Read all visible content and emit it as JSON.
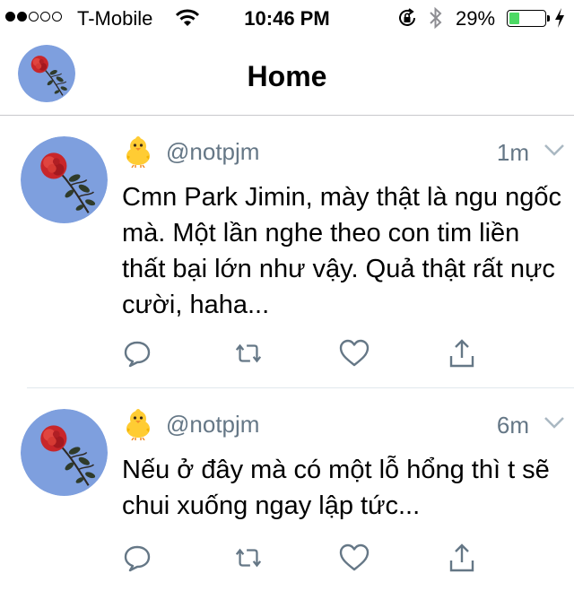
{
  "status_bar": {
    "carrier": "T-Mobile",
    "time": "10:46 PM",
    "battery_percent": "29%",
    "battery_level": 0.29,
    "signal_strength": 2,
    "signal_total": 5,
    "icons": [
      "signal-dots-icon",
      "wifi-icon",
      "rotation-lock-icon",
      "bluetooth-icon",
      "battery-icon",
      "charging-bolt-icon"
    ]
  },
  "nav": {
    "title": "Home",
    "avatar": "profile-avatar-rose"
  },
  "colors": {
    "secondary_text": "#657786",
    "divider": "#e1e8ed",
    "avatar_bg": "#7e9fde",
    "battery_fill": "#4cd964"
  },
  "tweets": [
    {
      "emoji": "🐥",
      "handle": "@notpjm",
      "time": "1m",
      "text": "Cmn Park Jimin, mày thật là ngu ngốc mà. Một lần nghe theo con tim liền thất bại lớn như vậy. Quả thật rất nực cười, haha..."
    },
    {
      "emoji": "🐥",
      "handle": "@notpjm",
      "time": "6m",
      "text": "Nếu ở đây mà có một lỗ hổng thì t sẽ chui xuống ngay lập tức..."
    }
  ],
  "tweet_actions": [
    "reply-icon",
    "retweet-icon",
    "like-icon",
    "share-icon"
  ]
}
